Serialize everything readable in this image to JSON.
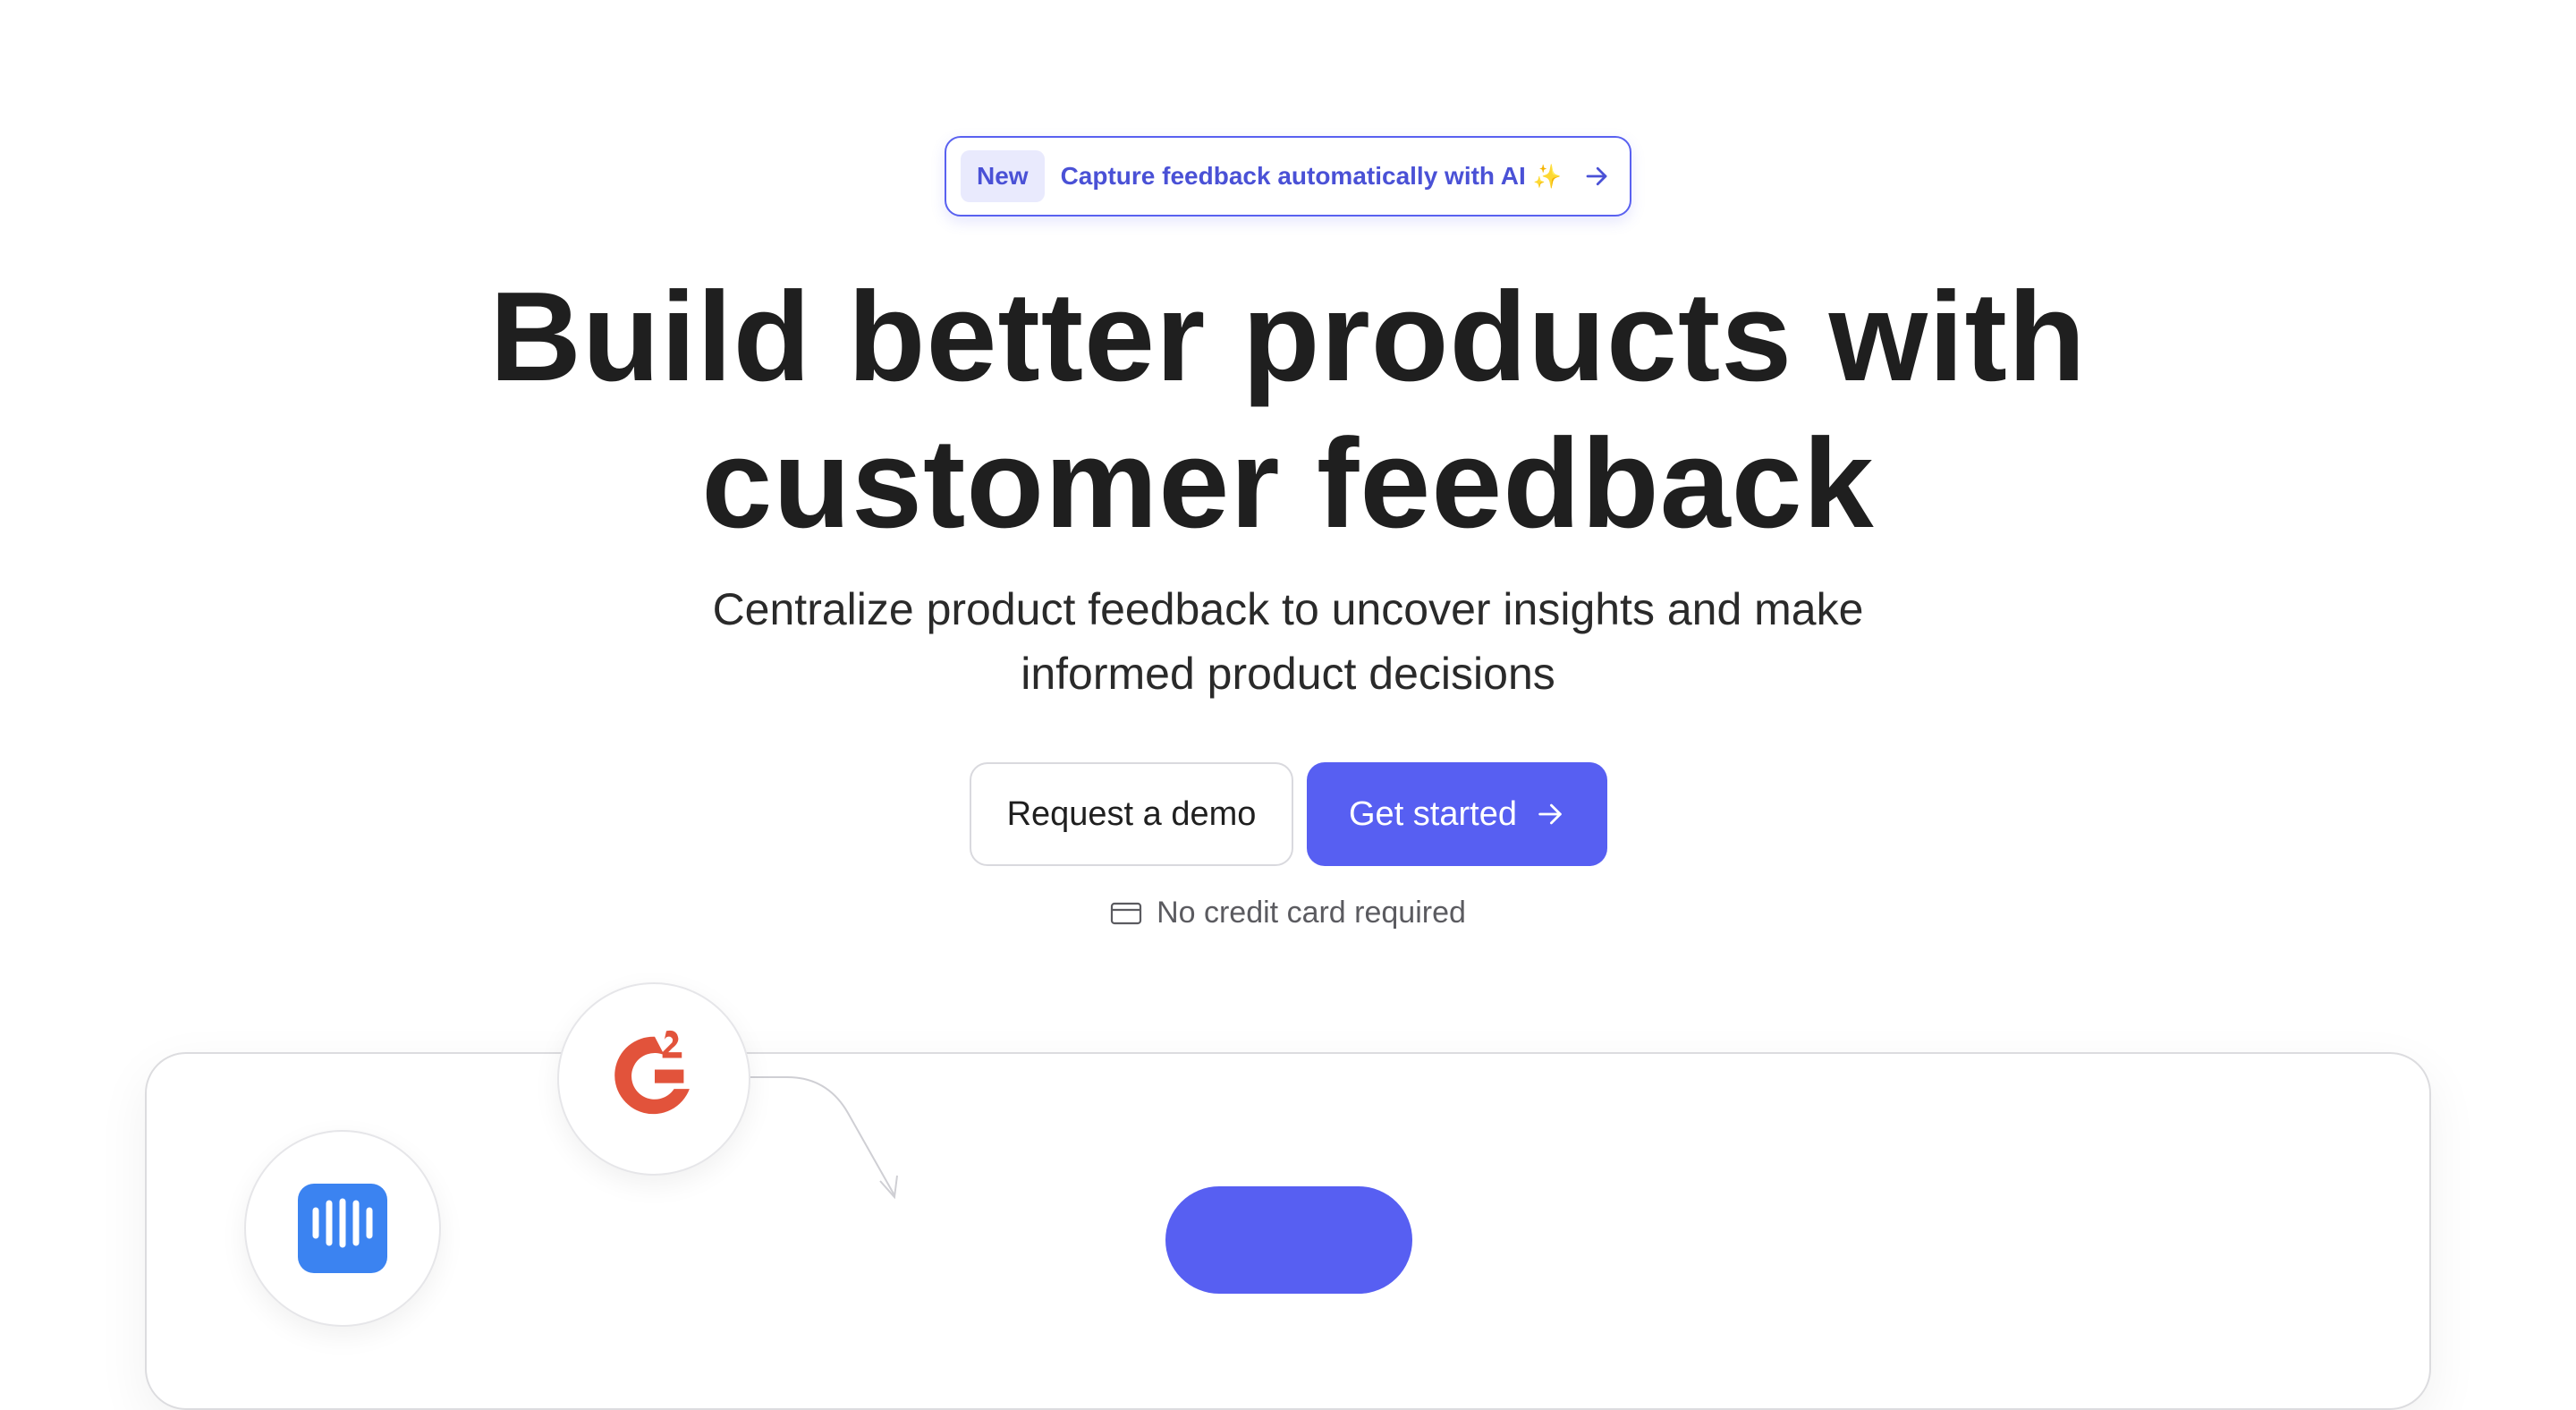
{
  "announcement": {
    "badge": "New",
    "text": "Capture feedback automatically with AI",
    "sparkle": "✨",
    "arrow_icon": "arrow-right-icon"
  },
  "hero": {
    "headline_line1": "Build better products with",
    "headline_line2": "customer feedback",
    "subhead_line1": "Centralize product feedback to uncover insights and make",
    "subhead_line2": "informed product decisions"
  },
  "cta": {
    "demo_label": "Request a demo",
    "start_label": "Get started",
    "note": "No credit card required",
    "note_icon": "credit-card-icon"
  },
  "preview": {
    "integrations": [
      "g2-logo",
      "intercom-logo"
    ]
  },
  "colors": {
    "accent": "#575ff2",
    "accent_text": "#4a51d6",
    "badge_bg": "#e9eafd",
    "g2_red": "#e2533b",
    "intercom_blue": "#3b83f1"
  }
}
